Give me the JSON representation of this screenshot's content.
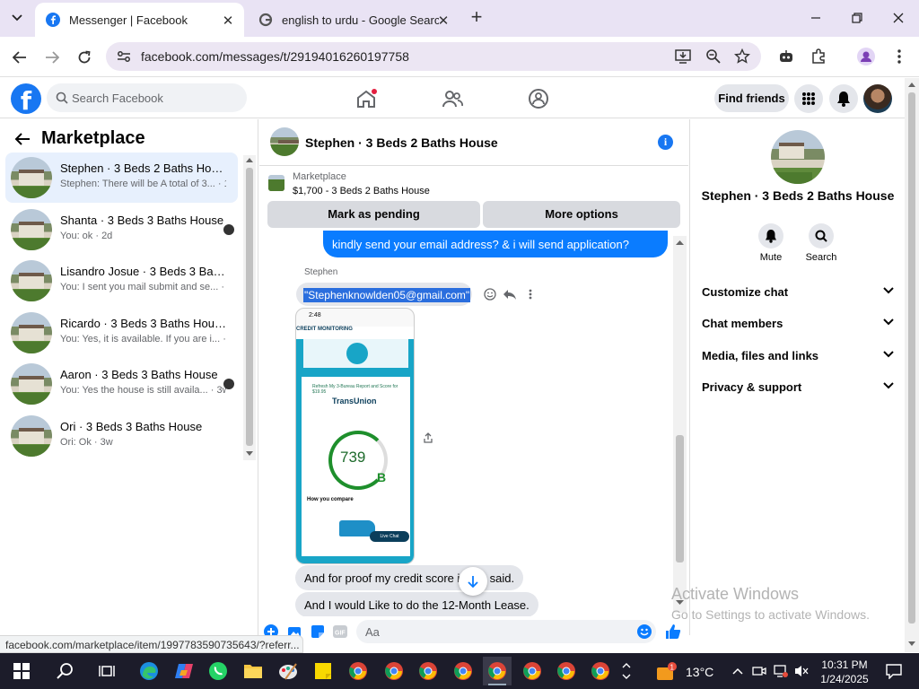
{
  "browser": {
    "tabs": [
      {
        "title": "Messenger | Facebook",
        "active": true
      },
      {
        "title": "english to urdu - Google Search",
        "active": false
      }
    ],
    "url": "facebook.com/messages/t/29194016260197758",
    "status_url": "facebook.com/marketplace/item/1997783590735643/?referr..."
  },
  "fb_header": {
    "search_placeholder": "Search Facebook",
    "find_friends": "Find friends"
  },
  "sidebar": {
    "title": "Marketplace",
    "chats": [
      {
        "name": "Stephen · 3 Beds 2 Baths House",
        "preview": "Stephen: There will be A total of 3... · 1m",
        "selected": true
      },
      {
        "name": "Shanta · 3 Beds 3 Baths House",
        "preview": "You: ok · 2d"
      },
      {
        "name": "Lisandro Josue · 3 Beds 3 Baths...",
        "preview": "You: I sent you mail submit and se... · 2w"
      },
      {
        "name": "Ricardo · 3 Beds 3 Baths House",
        "preview": "You: Yes, it is available. If you are i... · 2w"
      },
      {
        "name": "Aaron · 3 Beds 3 Baths House",
        "preview": "You: Yes the house is still availa... · 3w"
      },
      {
        "name": "Ori · 3 Beds 3 Baths House",
        "preview": "Ori: Ok · 3w"
      }
    ]
  },
  "conversation": {
    "title": "Stephen · 3 Beds 2 Baths House",
    "marketplace_label": "Marketplace",
    "listing": "$1,700 - 3 Beds 2 Baths House",
    "mark_pending": "Mark as pending",
    "more_options": "More options",
    "outgoing_message": "kindly send your email address? & i will send application?",
    "sender": "Stephen",
    "email_message": "\"Stephenknowlden05@gmail.com\"",
    "screenshot": {
      "time": "2:48",
      "brand": "CREDIT MONITORING",
      "refresh": "Refresh My 3-Bureau Report and Score for $19.95",
      "bureau": "TransUnion",
      "score": "739",
      "grade": "B",
      "compare": "How you compare",
      "live_chat": "Live Chat"
    },
    "message_2": "And for proof my credit score is w... said.",
    "message_3": "And I would Like to do the 12-Month Lease.",
    "composer_placeholder": "Aa"
  },
  "info_panel": {
    "title": "Stephen · 3 Beds 2 Baths House",
    "mute": "Mute",
    "search": "Search",
    "rows": [
      "Customize chat",
      "Chat members",
      "Media, files and links",
      "Privacy & support"
    ]
  },
  "watermark": {
    "line1": "Activate Windows",
    "line2": "Go to Settings to activate Windows."
  },
  "taskbar": {
    "temperature": "13°C",
    "time": "10:31 PM",
    "date": "1/24/2025",
    "weather_badge": "1"
  },
  "colors": {
    "messenger_blue": "#0a7cff",
    "facebook_blue": "#1877f2",
    "selected_chat": "#e7f0fd"
  }
}
